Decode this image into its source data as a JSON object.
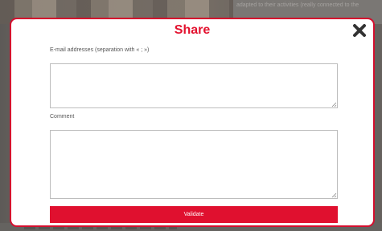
{
  "background": {
    "snippet_text": "adapted to their activities (really connected to the"
  },
  "modal": {
    "title": "Share",
    "close_icon": "close-x-icon",
    "email_label": "E-mail addresses (separation with « ; »)",
    "email_value": "",
    "comment_label": "Comment",
    "comment_value": "",
    "validate_label": "Validate"
  },
  "colors": {
    "accent": "#e0102f",
    "border": "#d40e2e",
    "label": "#555555"
  }
}
